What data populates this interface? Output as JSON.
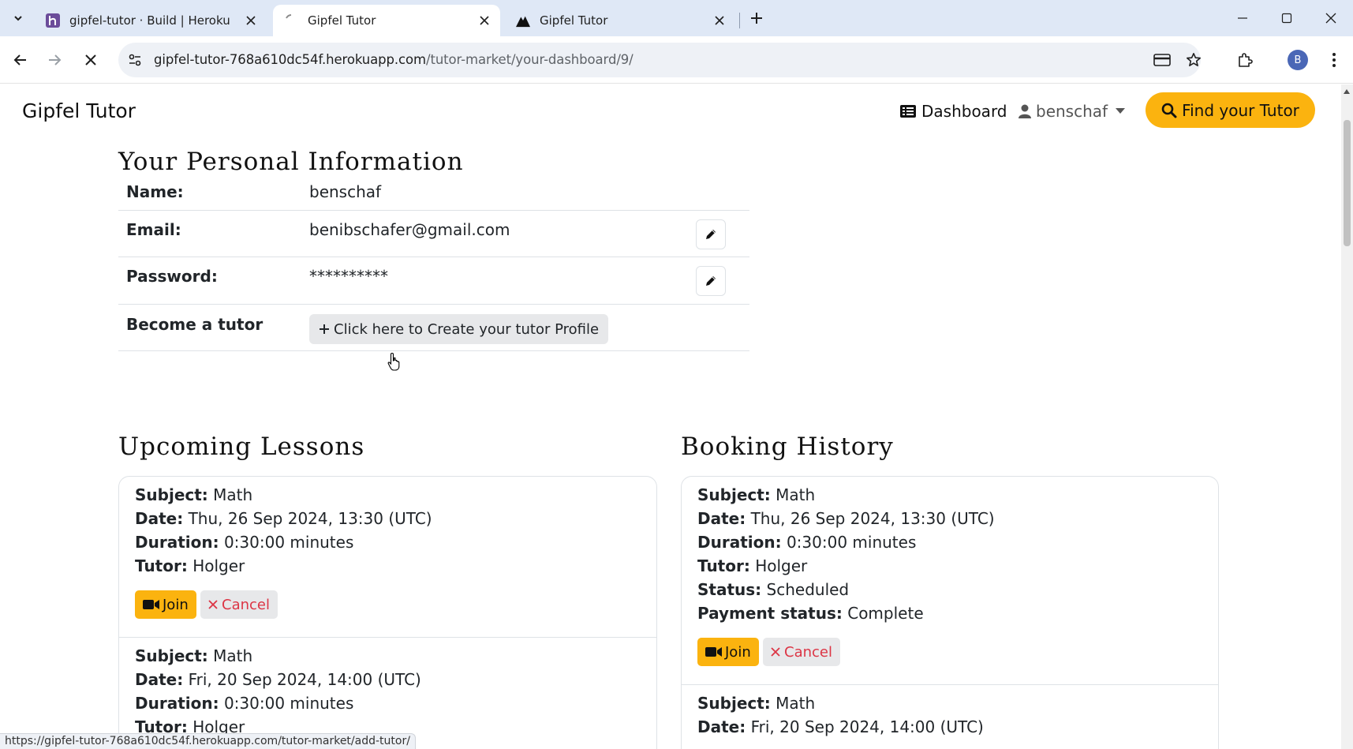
{
  "browser": {
    "tabs": [
      {
        "title": "gipfel-tutor · Build | Heroku",
        "favicon": "heroku-icon",
        "active": false
      },
      {
        "title": "Gipfel Tutor",
        "favicon": "loading-icon",
        "active": true
      },
      {
        "title": "Gipfel Tutor",
        "favicon": "mountain-icon",
        "active": false
      }
    ],
    "url_host": "gipfel-tutor-768a610dc54f.herokuapp.com",
    "url_path": "/tutor-market/your-dashboard/9/",
    "profile_initial": "B",
    "status_url": "https://gipfel-tutor-768a610dc54f.herokuapp.com/tutor-market/add-tutor/"
  },
  "navbar": {
    "brand": "Gipfel Tutor",
    "dashboard_label": "Dashboard",
    "user_label": "benschaf",
    "find_tutor_label": "Find your Tutor"
  },
  "personal_info": {
    "heading": "Your Personal Information",
    "name_label": "Name:",
    "name_value": "benschaf",
    "email_label": "Email:",
    "email_value": "benibschafer@gmail.com",
    "password_label": "Password:",
    "password_value": "**********",
    "become_tutor_label": "Become a tutor",
    "create_profile_button": "Click here to Create your tutor Profile"
  },
  "upcoming": {
    "heading": "Upcoming Lessons",
    "labels": {
      "subject": "Subject:",
      "date": "Date:",
      "duration": "Duration:",
      "tutor": "Tutor:"
    },
    "join_label": "Join",
    "cancel_label": "Cancel",
    "lessons": [
      {
        "subject": "Math",
        "date": "Thu, 26 Sep 2024, 13:30 (UTC)",
        "duration": "0:30:00 minutes",
        "tutor": "Holger"
      },
      {
        "subject": "Math",
        "date": "Fri, 20 Sep 2024, 14:00 (UTC)",
        "duration": "0:30:00 minutes",
        "tutor": "Holger"
      }
    ]
  },
  "history": {
    "heading": "Booking History",
    "labels": {
      "subject": "Subject:",
      "date": "Date:",
      "duration": "Duration:",
      "tutor": "Tutor:",
      "status": "Status:",
      "payment": "Payment status:"
    },
    "join_label": "Join",
    "cancel_label": "Cancel",
    "bookings": [
      {
        "subject": "Math",
        "date": "Thu, 26 Sep 2024, 13:30 (UTC)",
        "duration": "0:30:00 minutes",
        "tutor": "Holger",
        "status": "Scheduled",
        "payment": "Complete"
      },
      {
        "subject": "Math",
        "date": "Fri, 20 Sep 2024, 14:00 (UTC)"
      }
    ]
  },
  "colors": {
    "accent": "#fbb30f",
    "danger": "#dc3545",
    "tabstrip": "#dfe8f6"
  }
}
